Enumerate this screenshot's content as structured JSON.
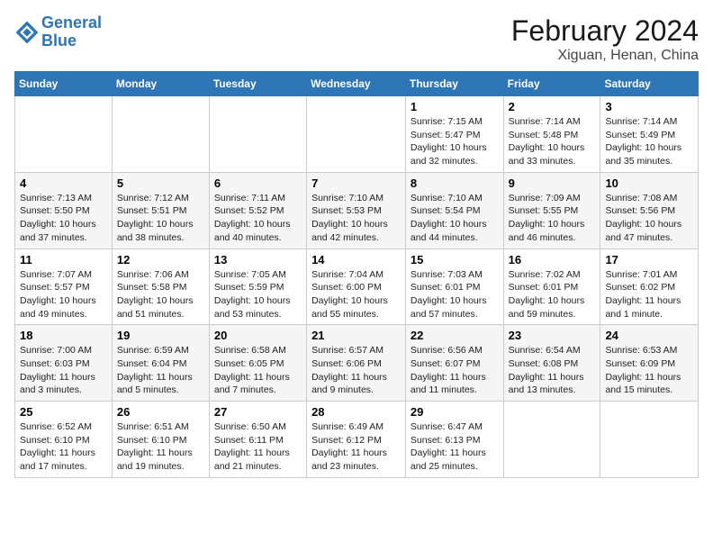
{
  "header": {
    "logo_line1": "General",
    "logo_line2": "Blue",
    "month_title": "February 2024",
    "location": "Xiguan, Henan, China"
  },
  "weekdays": [
    "Sunday",
    "Monday",
    "Tuesday",
    "Wednesday",
    "Thursday",
    "Friday",
    "Saturday"
  ],
  "weeks": [
    [
      {
        "day": "",
        "sunrise": "",
        "sunset": "",
        "daylight": ""
      },
      {
        "day": "",
        "sunrise": "",
        "sunset": "",
        "daylight": ""
      },
      {
        "day": "",
        "sunrise": "",
        "sunset": "",
        "daylight": ""
      },
      {
        "day": "",
        "sunrise": "",
        "sunset": "",
        "daylight": ""
      },
      {
        "day": "1",
        "sunrise": "Sunrise: 7:15 AM",
        "sunset": "Sunset: 5:47 PM",
        "daylight": "Daylight: 10 hours and 32 minutes."
      },
      {
        "day": "2",
        "sunrise": "Sunrise: 7:14 AM",
        "sunset": "Sunset: 5:48 PM",
        "daylight": "Daylight: 10 hours and 33 minutes."
      },
      {
        "day": "3",
        "sunrise": "Sunrise: 7:14 AM",
        "sunset": "Sunset: 5:49 PM",
        "daylight": "Daylight: 10 hours and 35 minutes."
      }
    ],
    [
      {
        "day": "4",
        "sunrise": "Sunrise: 7:13 AM",
        "sunset": "Sunset: 5:50 PM",
        "daylight": "Daylight: 10 hours and 37 minutes."
      },
      {
        "day": "5",
        "sunrise": "Sunrise: 7:12 AM",
        "sunset": "Sunset: 5:51 PM",
        "daylight": "Daylight: 10 hours and 38 minutes."
      },
      {
        "day": "6",
        "sunrise": "Sunrise: 7:11 AM",
        "sunset": "Sunset: 5:52 PM",
        "daylight": "Daylight: 10 hours and 40 minutes."
      },
      {
        "day": "7",
        "sunrise": "Sunrise: 7:10 AM",
        "sunset": "Sunset: 5:53 PM",
        "daylight": "Daylight: 10 hours and 42 minutes."
      },
      {
        "day": "8",
        "sunrise": "Sunrise: 7:10 AM",
        "sunset": "Sunset: 5:54 PM",
        "daylight": "Daylight: 10 hours and 44 minutes."
      },
      {
        "day": "9",
        "sunrise": "Sunrise: 7:09 AM",
        "sunset": "Sunset: 5:55 PM",
        "daylight": "Daylight: 10 hours and 46 minutes."
      },
      {
        "day": "10",
        "sunrise": "Sunrise: 7:08 AM",
        "sunset": "Sunset: 5:56 PM",
        "daylight": "Daylight: 10 hours and 47 minutes."
      }
    ],
    [
      {
        "day": "11",
        "sunrise": "Sunrise: 7:07 AM",
        "sunset": "Sunset: 5:57 PM",
        "daylight": "Daylight: 10 hours and 49 minutes."
      },
      {
        "day": "12",
        "sunrise": "Sunrise: 7:06 AM",
        "sunset": "Sunset: 5:58 PM",
        "daylight": "Daylight: 10 hours and 51 minutes."
      },
      {
        "day": "13",
        "sunrise": "Sunrise: 7:05 AM",
        "sunset": "Sunset: 5:59 PM",
        "daylight": "Daylight: 10 hours and 53 minutes."
      },
      {
        "day": "14",
        "sunrise": "Sunrise: 7:04 AM",
        "sunset": "Sunset: 6:00 PM",
        "daylight": "Daylight: 10 hours and 55 minutes."
      },
      {
        "day": "15",
        "sunrise": "Sunrise: 7:03 AM",
        "sunset": "Sunset: 6:01 PM",
        "daylight": "Daylight: 10 hours and 57 minutes."
      },
      {
        "day": "16",
        "sunrise": "Sunrise: 7:02 AM",
        "sunset": "Sunset: 6:01 PM",
        "daylight": "Daylight: 10 hours and 59 minutes."
      },
      {
        "day": "17",
        "sunrise": "Sunrise: 7:01 AM",
        "sunset": "Sunset: 6:02 PM",
        "daylight": "Daylight: 11 hours and 1 minute."
      }
    ],
    [
      {
        "day": "18",
        "sunrise": "Sunrise: 7:00 AM",
        "sunset": "Sunset: 6:03 PM",
        "daylight": "Daylight: 11 hours and 3 minutes."
      },
      {
        "day": "19",
        "sunrise": "Sunrise: 6:59 AM",
        "sunset": "Sunset: 6:04 PM",
        "daylight": "Daylight: 11 hours and 5 minutes."
      },
      {
        "day": "20",
        "sunrise": "Sunrise: 6:58 AM",
        "sunset": "Sunset: 6:05 PM",
        "daylight": "Daylight: 11 hours and 7 minutes."
      },
      {
        "day": "21",
        "sunrise": "Sunrise: 6:57 AM",
        "sunset": "Sunset: 6:06 PM",
        "daylight": "Daylight: 11 hours and 9 minutes."
      },
      {
        "day": "22",
        "sunrise": "Sunrise: 6:56 AM",
        "sunset": "Sunset: 6:07 PM",
        "daylight": "Daylight: 11 hours and 11 minutes."
      },
      {
        "day": "23",
        "sunrise": "Sunrise: 6:54 AM",
        "sunset": "Sunset: 6:08 PM",
        "daylight": "Daylight: 11 hours and 13 minutes."
      },
      {
        "day": "24",
        "sunrise": "Sunrise: 6:53 AM",
        "sunset": "Sunset: 6:09 PM",
        "daylight": "Daylight: 11 hours and 15 minutes."
      }
    ],
    [
      {
        "day": "25",
        "sunrise": "Sunrise: 6:52 AM",
        "sunset": "Sunset: 6:10 PM",
        "daylight": "Daylight: 11 hours and 17 minutes."
      },
      {
        "day": "26",
        "sunrise": "Sunrise: 6:51 AM",
        "sunset": "Sunset: 6:10 PM",
        "daylight": "Daylight: 11 hours and 19 minutes."
      },
      {
        "day": "27",
        "sunrise": "Sunrise: 6:50 AM",
        "sunset": "Sunset: 6:11 PM",
        "daylight": "Daylight: 11 hours and 21 minutes."
      },
      {
        "day": "28",
        "sunrise": "Sunrise: 6:49 AM",
        "sunset": "Sunset: 6:12 PM",
        "daylight": "Daylight: 11 hours and 23 minutes."
      },
      {
        "day": "29",
        "sunrise": "Sunrise: 6:47 AM",
        "sunset": "Sunset: 6:13 PM",
        "daylight": "Daylight: 11 hours and 25 minutes."
      },
      {
        "day": "",
        "sunrise": "",
        "sunset": "",
        "daylight": ""
      },
      {
        "day": "",
        "sunrise": "",
        "sunset": "",
        "daylight": ""
      }
    ]
  ]
}
